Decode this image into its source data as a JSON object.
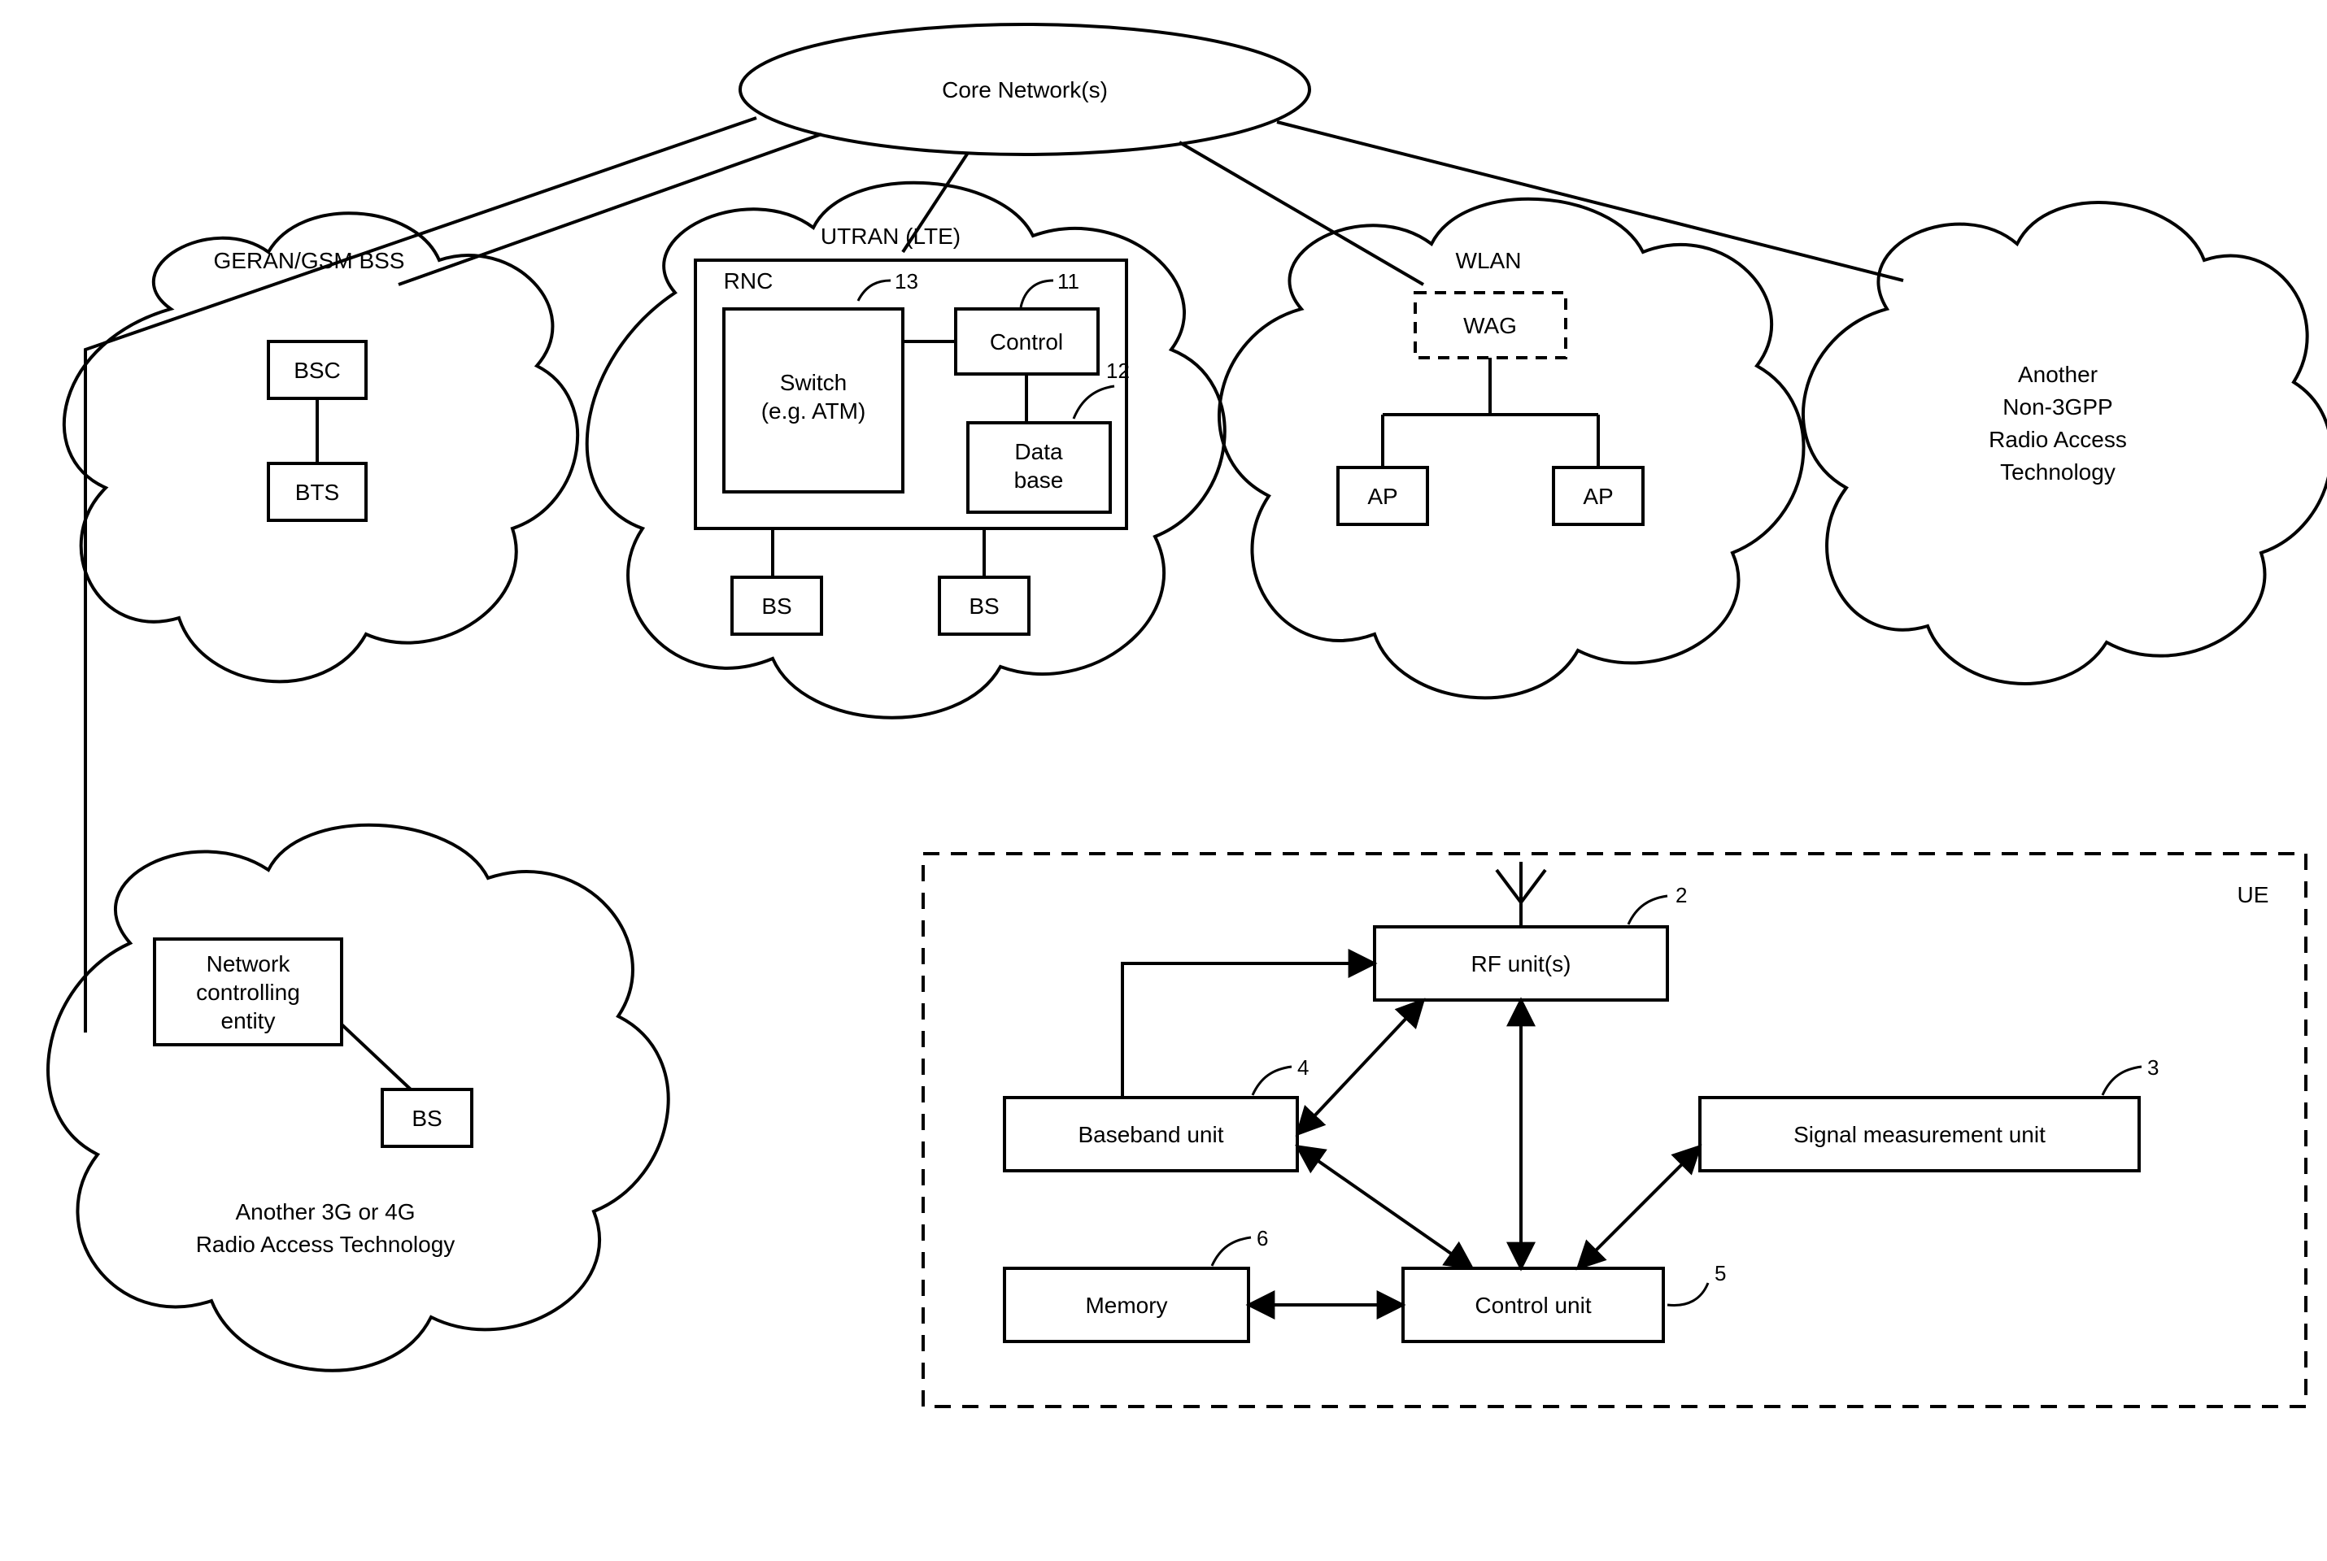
{
  "core": {
    "title": "Core Network(s)"
  },
  "geran": {
    "title": "GERAN/GSM BSS",
    "bsc": "BSC",
    "bts": "BTS"
  },
  "utran": {
    "title": "UTRAN (LTE)",
    "rnc": "RNC",
    "switch_line1": "Switch",
    "switch_line2": "(e.g. ATM)",
    "control": "Control",
    "database_line1": "Data",
    "database_line2": "base",
    "bs1": "BS",
    "bs2": "BS",
    "ref11": "11",
    "ref12": "12",
    "ref13": "13"
  },
  "wlan": {
    "title": "WLAN",
    "wag": "WAG",
    "ap1": "AP",
    "ap2": "AP"
  },
  "another_non3gpp": {
    "line1": "Another",
    "line2": "Non-3GPP",
    "line3": "Radio Access",
    "line4": "Technology"
  },
  "another_3g4g": {
    "nce_line1": "Network",
    "nce_line2": "controlling",
    "nce_line3": "entity",
    "bs": "BS",
    "caption_line1": "Another 3G or 4G",
    "caption_line2": "Radio Access Technology"
  },
  "ue": {
    "title": "UE",
    "rf": "RF unit(s)",
    "baseband": "Baseband unit",
    "signal": "Signal measurement unit",
    "memory": "Memory",
    "control": "Control unit",
    "ref2": "2",
    "ref3": "3",
    "ref4": "4",
    "ref5": "5",
    "ref6": "6"
  }
}
